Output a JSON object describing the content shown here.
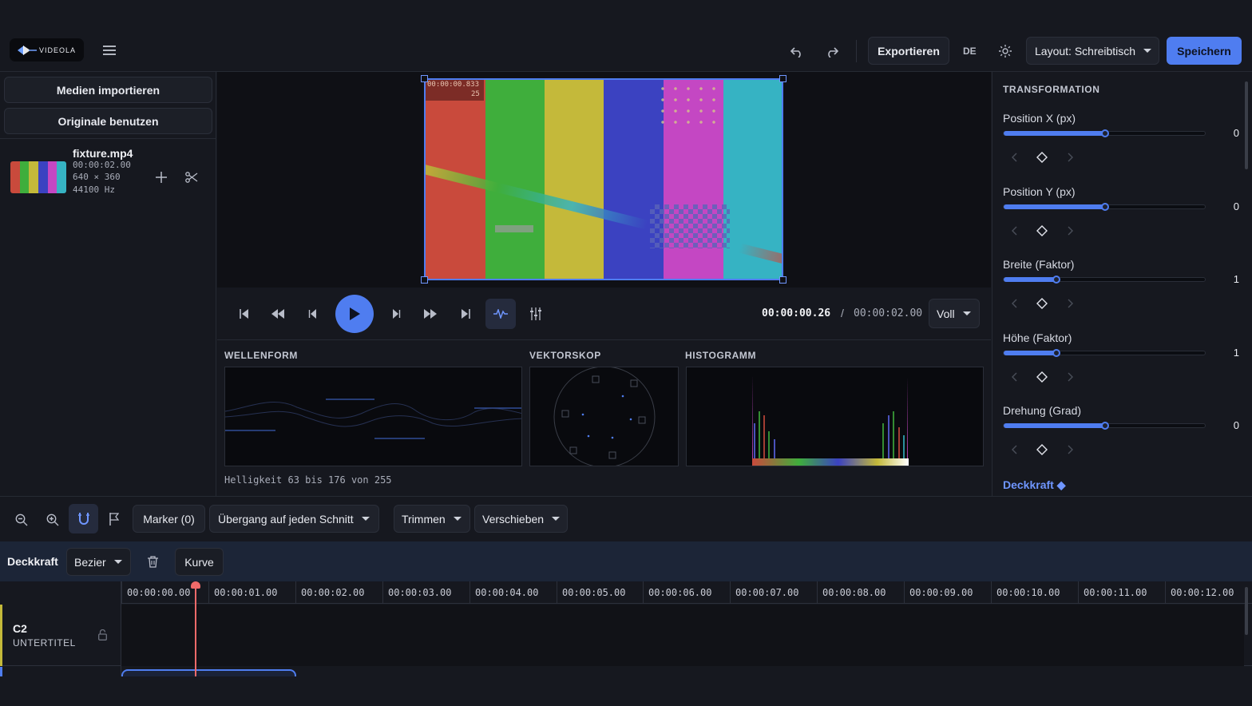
{
  "app": {
    "logo_text": "VIDEOLA"
  },
  "topbar": {
    "export_label": "Exportieren",
    "lang_label": "DE",
    "layout_label": "Layout: Schreibtisch",
    "save_label": "Speichern"
  },
  "left": {
    "import_label": "Medien importieren",
    "originals_label": "Originale benutzen",
    "media": {
      "name": "fixture.mp4",
      "duration": "00:00:02.00",
      "resolution": "640 × 360",
      "audio": "44100 Hz"
    }
  },
  "preview": {
    "overlay_time": "00:00:00.833",
    "overlay_frame": "25",
    "colors": [
      "#c94a3c",
      "#3fae3c",
      "#c4b93a",
      "#3b42c1",
      "#c447c3",
      "#36b3c3"
    ]
  },
  "transport": {
    "current_time": "00:00:00.26",
    "separator": "/",
    "total_time": "00:00:02.00",
    "zoom_label": "Voll"
  },
  "scopes": {
    "waveform_label": "WELLENFORM",
    "vectorscope_label": "VEKTORSKOP",
    "histogram_label": "HISTOGRAMM",
    "brightness_info": "Helligkeit 63 bis 176 von 255"
  },
  "transform": {
    "title": "TRANSFORMATION",
    "props": [
      {
        "label": "Position X (px)",
        "value": "0",
        "level": 0.5
      },
      {
        "label": "Position Y (px)",
        "value": "0",
        "level": 0.5
      },
      {
        "label": "Breite (Faktor)",
        "value": "1",
        "level": 0.26
      },
      {
        "label": "Höhe (Faktor)",
        "value": "1",
        "level": 0.26
      },
      {
        "label": "Drehung (Grad)",
        "value": "0",
        "level": 0.5
      }
    ],
    "opacity_label": "Deckkraft ◆"
  },
  "timeline_toolbar": {
    "marker_label": "Marker (0)",
    "transition_label": "Übergang auf jeden Schnitt",
    "trim_label": "Trimmen",
    "move_label": "Verschieben"
  },
  "keyframe_bar": {
    "title": "Deckkraft",
    "interp_label": "Bezier",
    "curve_label": "Kurve"
  },
  "ruler": {
    "ticks": [
      "00:00:00.00",
      "00:00:01.00",
      "00:00:02.00",
      "00:00:03.00",
      "00:00:04.00",
      "00:00:05.00",
      "00:00:06.00",
      "00:00:07.00",
      "00:00:08.00",
      "00:00:09.00",
      "00:00:10.00",
      "00:00:11.00",
      "00:00:12.00"
    ]
  },
  "track": {
    "name": "C2",
    "type": "UNTERTITEL"
  }
}
